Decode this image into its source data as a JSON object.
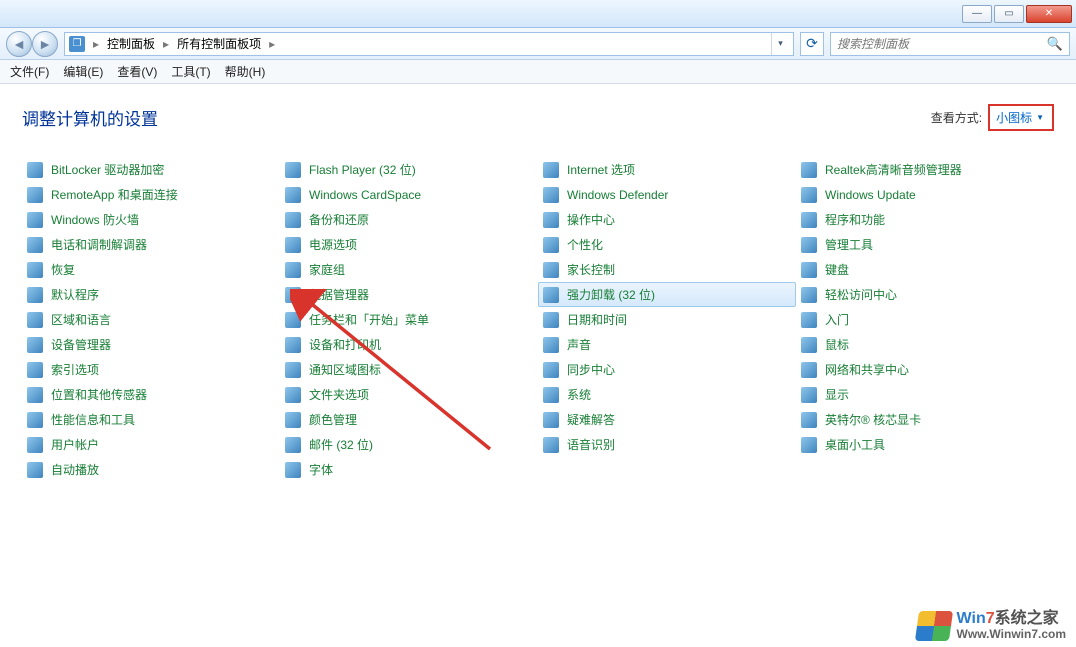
{
  "window": {
    "min_tip": "—",
    "max_tip": "▭",
    "close_tip": "✕"
  },
  "breadcrumb": {
    "root_icon": "❐",
    "items": [
      "控制面板",
      "所有控制面板项"
    ]
  },
  "search": {
    "placeholder": "搜索控制面板"
  },
  "menu": {
    "file": "文件(F)",
    "edit": "编辑(E)",
    "view": "查看(V)",
    "tools": "工具(T)",
    "help": "帮助(H)"
  },
  "page": {
    "title": "调整计算机的设置",
    "view_label": "查看方式:",
    "view_value": "小图标"
  },
  "items": [
    {
      "label": "BitLocker 驱动器加密",
      "col": 0
    },
    {
      "label": "Flash Player (32 位)",
      "col": 1
    },
    {
      "label": "Internet 选项",
      "col": 2
    },
    {
      "label": "Realtek高清晰音频管理器",
      "col": 3
    },
    {
      "label": "RemoteApp 和桌面连接",
      "col": 0
    },
    {
      "label": "Windows CardSpace",
      "col": 1
    },
    {
      "label": "Windows Defender",
      "col": 2
    },
    {
      "label": "Windows Update",
      "col": 3
    },
    {
      "label": "Windows 防火墙",
      "col": 0
    },
    {
      "label": "备份和还原",
      "col": 1
    },
    {
      "label": "操作中心",
      "col": 2
    },
    {
      "label": "程序和功能",
      "col": 3
    },
    {
      "label": "电话和调制解调器",
      "col": 0
    },
    {
      "label": "电源选项",
      "col": 1
    },
    {
      "label": "个性化",
      "col": 2
    },
    {
      "label": "管理工具",
      "col": 3
    },
    {
      "label": "恢复",
      "col": 0
    },
    {
      "label": "家庭组",
      "col": 1
    },
    {
      "label": "家长控制",
      "col": 2
    },
    {
      "label": "键盘",
      "col": 3
    },
    {
      "label": "默认程序",
      "col": 0
    },
    {
      "label": "凭据管理器",
      "col": 1
    },
    {
      "label": "强力卸载 (32 位)",
      "col": 2,
      "selected": true
    },
    {
      "label": "轻松访问中心",
      "col": 3
    },
    {
      "label": "区域和语言",
      "col": 0
    },
    {
      "label": "任务栏和「开始」菜单",
      "col": 1
    },
    {
      "label": "日期和时间",
      "col": 2
    },
    {
      "label": "入门",
      "col": 3
    },
    {
      "label": "设备管理器",
      "col": 0
    },
    {
      "label": "设备和打印机",
      "col": 1
    },
    {
      "label": "声音",
      "col": 2
    },
    {
      "label": "鼠标",
      "col": 3
    },
    {
      "label": "索引选项",
      "col": 0
    },
    {
      "label": "通知区域图标",
      "col": 1
    },
    {
      "label": "同步中心",
      "col": 2
    },
    {
      "label": "网络和共享中心",
      "col": 3
    },
    {
      "label": "位置和其他传感器",
      "col": 0
    },
    {
      "label": "文件夹选项",
      "col": 1
    },
    {
      "label": "系统",
      "col": 2
    },
    {
      "label": "显示",
      "col": 3
    },
    {
      "label": "性能信息和工具",
      "col": 0
    },
    {
      "label": "颜色管理",
      "col": 1
    },
    {
      "label": "疑难解答",
      "col": 2
    },
    {
      "label": "英特尔® 核芯显卡",
      "col": 3
    },
    {
      "label": "用户帐户",
      "col": 0
    },
    {
      "label": "邮件 (32 位)",
      "col": 1
    },
    {
      "label": "语音识别",
      "col": 2
    },
    {
      "label": "桌面小工具",
      "col": 3
    },
    {
      "label": "自动播放",
      "col": 0
    },
    {
      "label": "字体",
      "col": 1
    }
  ],
  "watermark": {
    "line1_a": "Win",
    "line1_b": "7",
    "line1_rest": "系统之家",
    "line2": "Www.Winwin7.com"
  }
}
